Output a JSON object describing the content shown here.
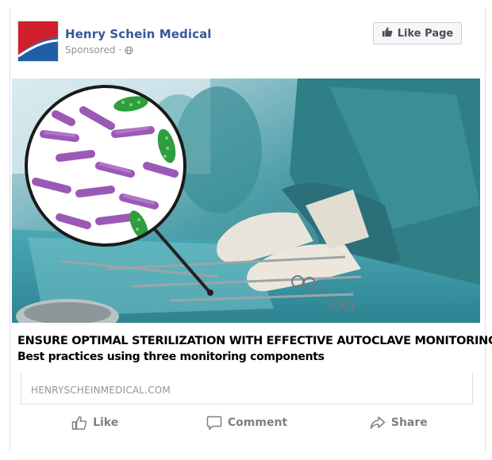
{
  "post": {
    "page_name": "Henry Schein Medical",
    "sponsored_label": "Sponsored",
    "sponsored_separator": "·",
    "like_page_label": "Like Page",
    "globe_icon": "globe-icon",
    "headline": "ENSURE OPTIMAL STERILIZATION WITH EFFECTIVE AUTOCLAVE MONITORING",
    "subheadline": "Best practices using three monitoring components",
    "link_domain": "HENRYSCHEINMEDICAL.COM"
  },
  "actions": {
    "like_label": "Like",
    "comment_label": "Comment",
    "share_label": "Share"
  },
  "colors": {
    "brand_link": "#365899",
    "logo_red": "#d0202e",
    "logo_blue": "#1f5fa8",
    "scrubs_teal": "#2f7f86",
    "bacteria_purple": "#9b59b6",
    "bacteria_green": "#2e9e3f"
  }
}
